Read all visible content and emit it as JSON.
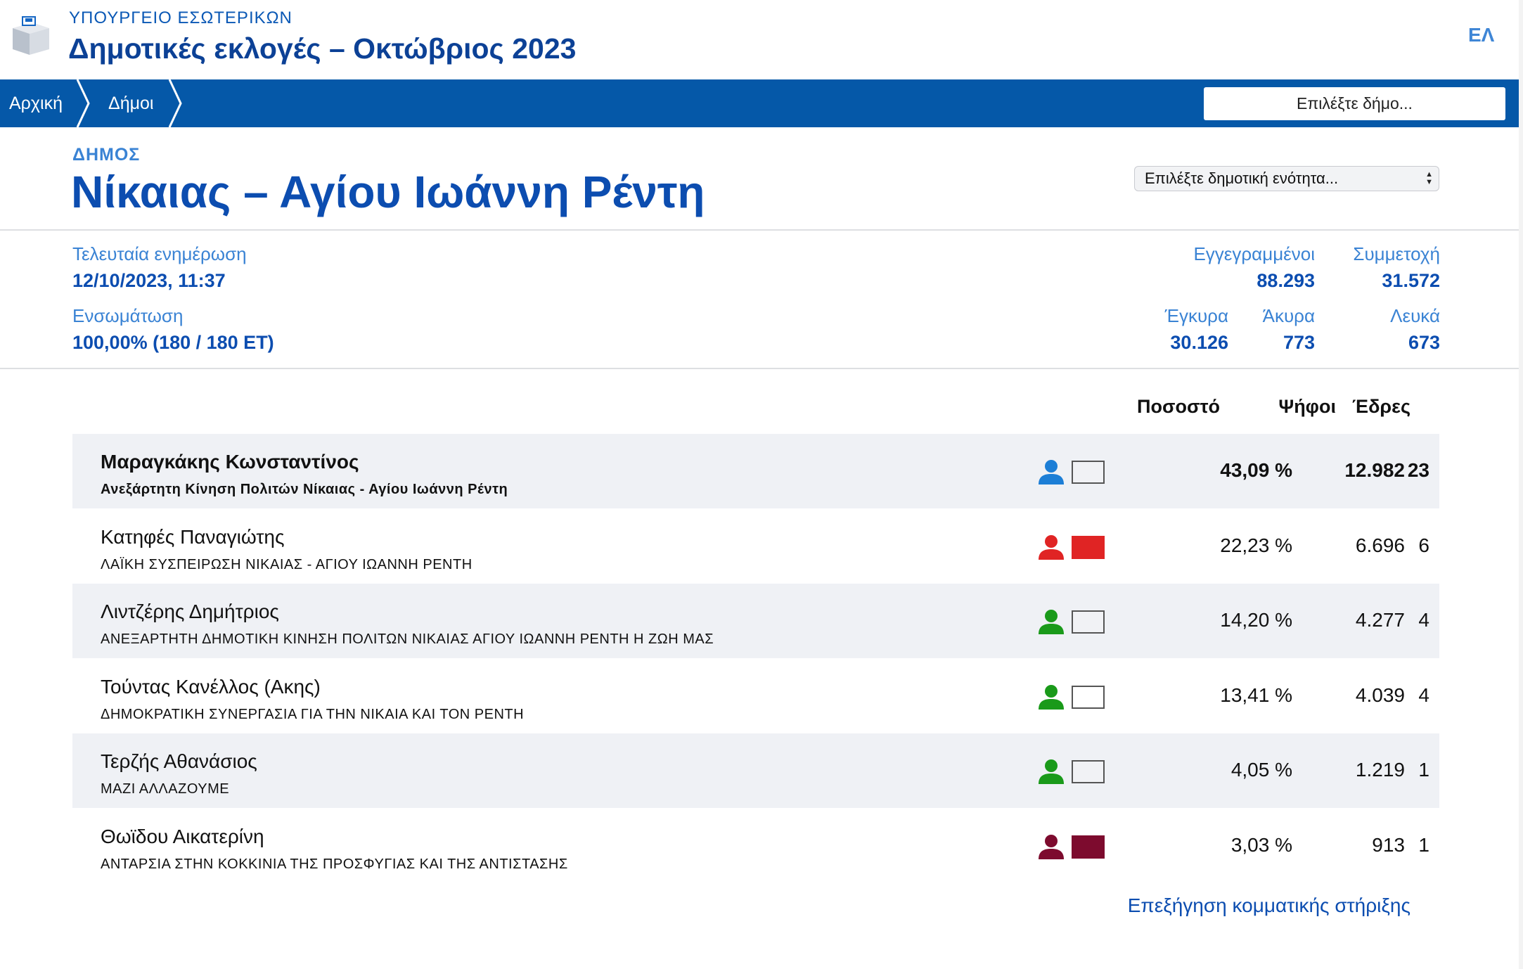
{
  "header": {
    "ministry": "ΥΠΟΥΡΓΕΙΟ ΕΣΩΤΕΡΙΚΩΝ",
    "title": "Δημοτικές εκλογές – Οκτώβριος 2023",
    "language": "ΕΛ"
  },
  "nav": {
    "home": "Αρχική",
    "municipalities": "Δήμοι",
    "select_municipality": "Επιλέξτε δήμο..."
  },
  "municipality": {
    "label": "ΔΗΜΟΣ",
    "name": "Νίκαιας – Αγίου Ιωάννη Ρέντη",
    "unit_select": "Επιλέξτε δημοτική ενότητα..."
  },
  "stats": {
    "last_update_label": "Τελευταία ενημέρωση",
    "last_update": "12/10/2023, 11:37",
    "integration_label": "Ενσωμάτωση",
    "integration": "100,00% (180 / 180 ΕΤ)",
    "registered_label": "Εγγεγραμμένοι",
    "registered": "88.293",
    "turnout_label": "Συμμετοχή",
    "turnout": "31.572",
    "valid_label": "Έγκυρα",
    "valid": "30.126",
    "invalid_label": "Άκυρα",
    "invalid": "773",
    "blank_label": "Λευκά",
    "blank": "673"
  },
  "table": {
    "headers": {
      "percent": "Ποσοστό",
      "votes": "Ψήφοι",
      "seats": "Έδρες"
    },
    "rows": [
      {
        "candidate": "Μαραγκάκης Κωνσταντίνος",
        "party": "Ανεξάρτητη Κίνηση Πολιτών Νίκαιας - Αγίου Ιωάννη Ρέντη",
        "percent": "43,09 %",
        "votes": "12.982",
        "seats": "23",
        "person_color": "#1c7ed6",
        "flag_color": "#f1f2f5"
      },
      {
        "candidate": "Κατηφές Παναγιώτης",
        "party": "ΛΑΪΚΗ ΣΥΣΠΕΙΡΩΣΗ ΝΙΚΑΙΑΣ - ΑΓΙΟΥ ΙΩΑΝΝΗ ΡΕΝΤΗ",
        "percent": "22,23 %",
        "votes": "6.696",
        "seats": "6",
        "person_color": "#e02424",
        "flag_color": "#e02424"
      },
      {
        "candidate": "Λιντζέρης Δημήτριος",
        "party": "ΑΝΕΞΑΡΤΗΤΗ ΔΗΜΟΤΙΚΗ ΚΙΝΗΣΗ ΠΟΛΙΤΩΝ ΝΙΚΑΙΑΣ ΑΓΙΟΥ ΙΩΑΝΝΗ ΡΕΝΤΗ Η ΖΩΗ ΜΑΣ",
        "percent": "14,20 %",
        "votes": "4.277",
        "seats": "4",
        "person_color": "#1a9a1a",
        "flag_color": "#f1f2f5"
      },
      {
        "candidate": "Τούντας Κανέλλος (Ακης)",
        "party": "ΔΗΜΟΚΡΑΤΙΚΗ ΣΥΝΕΡΓΑΣΙΑ ΓΙΑ ΤΗΝ ΝΙΚΑΙΑ ΚΑΙ ΤΟΝ ΡΕΝΤΗ",
        "percent": "13,41 %",
        "votes": "4.039",
        "seats": "4",
        "person_color": "#1a9a1a",
        "flag_color": "#ffffff"
      },
      {
        "candidate": "Τερζής Αθανάσιος",
        "party": "ΜΑΖΙ ΑΛΛΑΖΟΥΜΕ",
        "percent": "4,05 %",
        "votes": "1.219",
        "seats": "1",
        "person_color": "#1a9a1a",
        "flag_color": "#f1f2f5"
      },
      {
        "candidate": "Θωϊδου Αικατερίνη",
        "party": "ΑΝΤΑΡΣΙΑ ΣΤΗΝ ΚΟΚΚΙΝΙΑ ΤΗΣ ΠΡΟΣΦΥΓΙΑΣ ΚΑΙ ΤΗΣ ΑΝΤΙΣΤΑΣΗΣ",
        "percent": "3,03 %",
        "votes": "913",
        "seats": "1",
        "person_color": "#7d0b2e",
        "flag_color": "#7d0b2e"
      }
    ]
  },
  "footer": {
    "party_support_link": "Επεξήγηση κομματικής στήριξης"
  }
}
